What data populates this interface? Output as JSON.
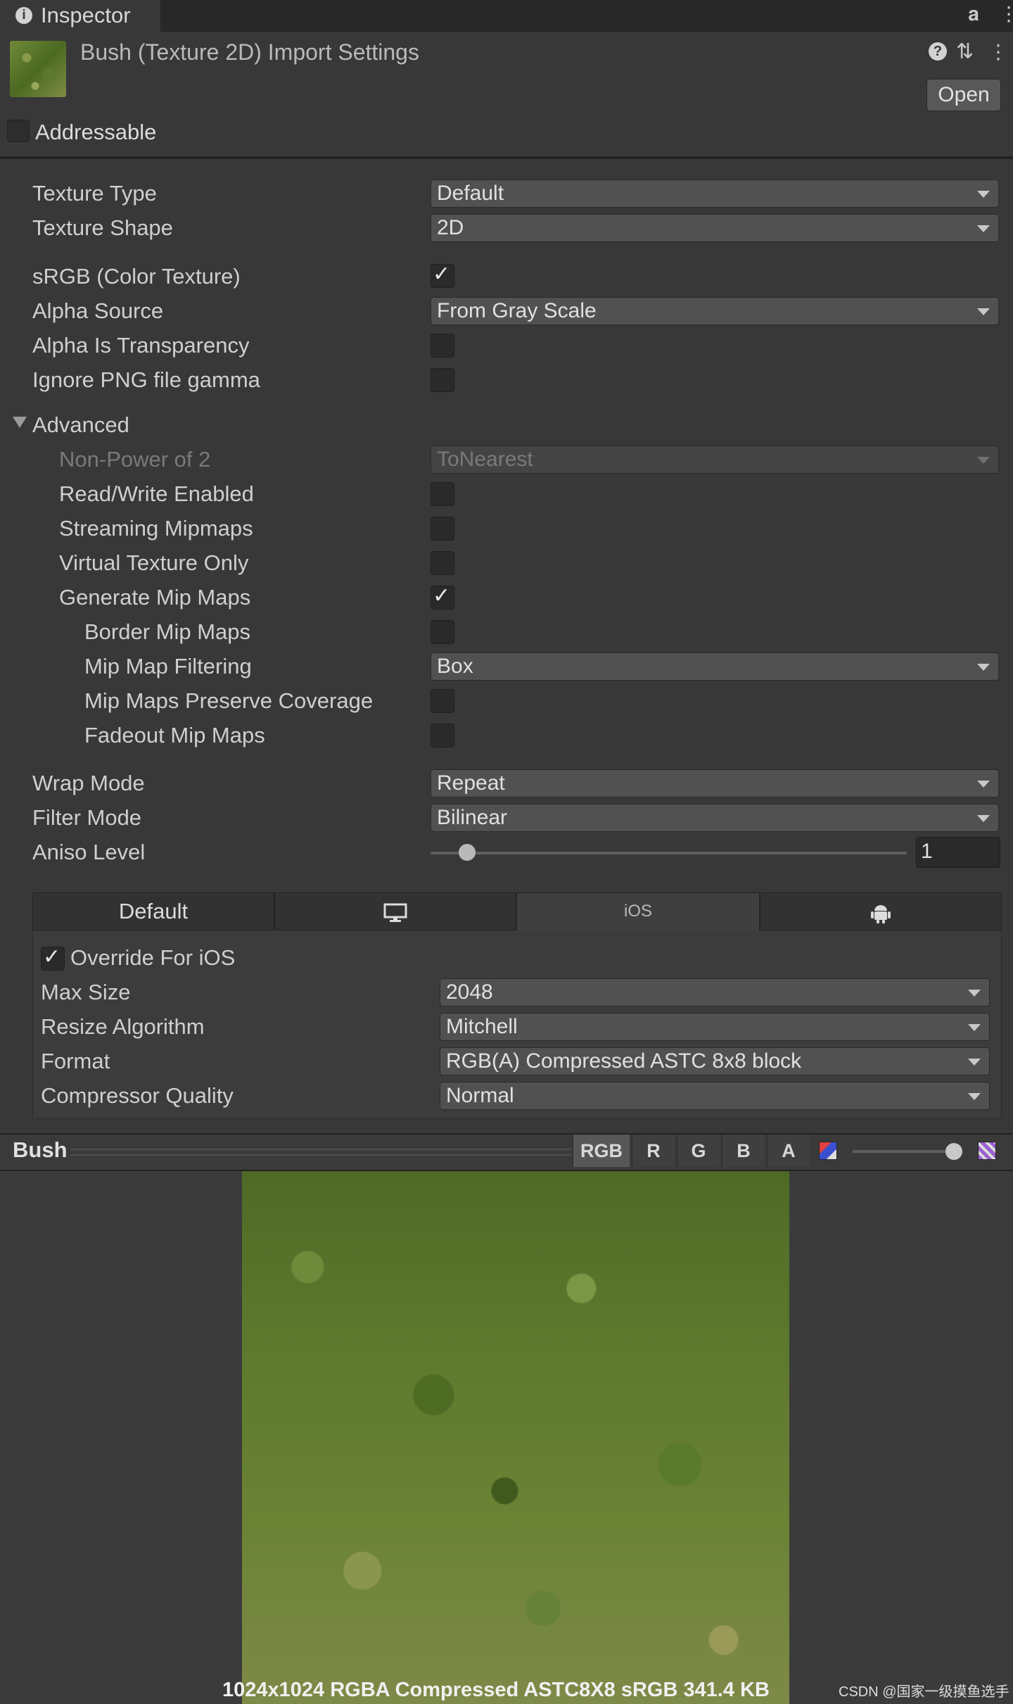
{
  "tab": {
    "label": "Inspector"
  },
  "header": {
    "title": "Bush (Texture 2D) Import Settings",
    "open_label": "Open"
  },
  "addressable": {
    "label": "Addressable",
    "checked": false
  },
  "settings": {
    "texture_type": {
      "label": "Texture Type",
      "value": "Default"
    },
    "texture_shape": {
      "label": "Texture Shape",
      "value": "2D"
    },
    "srgb": {
      "label": "sRGB (Color Texture)",
      "checked": true
    },
    "alpha_source": {
      "label": "Alpha Source",
      "value": "From Gray Scale"
    },
    "alpha_transparency": {
      "label": "Alpha Is Transparency",
      "checked": false
    },
    "ignore_png_gamma": {
      "label": "Ignore PNG file gamma",
      "checked": false
    }
  },
  "advanced": {
    "label": "Advanced",
    "non_power_of_2": {
      "label": "Non-Power of 2",
      "value": "ToNearest"
    },
    "read_write": {
      "label": "Read/Write Enabled",
      "checked": false
    },
    "streaming_mipmaps": {
      "label": "Streaming Mipmaps",
      "checked": false
    },
    "virtual_texture": {
      "label": "Virtual Texture Only",
      "checked": false
    },
    "generate_mipmaps": {
      "label": "Generate Mip Maps",
      "checked": true
    },
    "border_mipmaps": {
      "label": "Border Mip Maps",
      "checked": false
    },
    "mipmap_filtering": {
      "label": "Mip Map Filtering",
      "value": "Box"
    },
    "preserve_coverage": {
      "label": "Mip Maps Preserve Coverage",
      "checked": false
    },
    "fadeout_mipmaps": {
      "label": "Fadeout Mip Maps",
      "checked": false
    }
  },
  "wrap_mode": {
    "label": "Wrap Mode",
    "value": "Repeat"
  },
  "filter_mode": {
    "label": "Filter Mode",
    "value": "Bilinear"
  },
  "aniso_level": {
    "label": "Aniso Level",
    "value": "1"
  },
  "platforms": {
    "tabs": [
      "Default",
      "monitor-icon",
      "iOS",
      "android-icon"
    ],
    "default_label": "Default",
    "ios_label": "iOS",
    "active": "iOS"
  },
  "ios": {
    "override": {
      "label": "Override For iOS",
      "checked": true
    },
    "max_size": {
      "label": "Max Size",
      "value": "2048"
    },
    "resize_algorithm": {
      "label": "Resize Algorithm",
      "value": "Mitchell"
    },
    "format": {
      "label": "Format",
      "value": "RGB(A) Compressed ASTC 8x8 block"
    },
    "compressor_quality": {
      "label": "Compressor Quality",
      "value": "Normal"
    }
  },
  "preview": {
    "title": "Bush",
    "channels": [
      "RGB",
      "R",
      "G",
      "B",
      "A"
    ],
    "info": "1024x1024  RGBA Compressed ASTC8X8 sRGB  341.4 KB"
  },
  "watermark": "CSDN @国家一级摸鱼选手"
}
